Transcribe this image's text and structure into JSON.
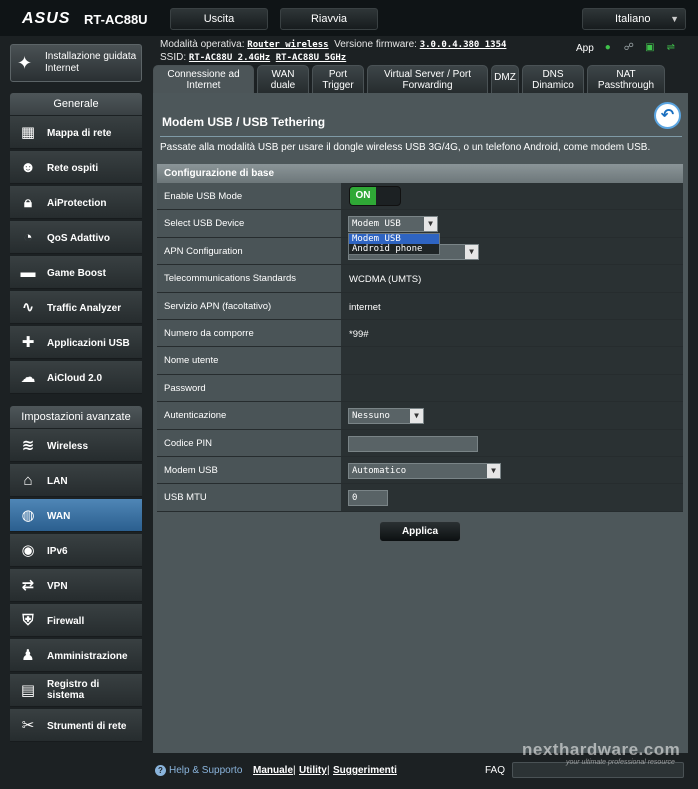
{
  "header": {
    "brand": "ASUS",
    "model": "RT-AC88U",
    "logout_label": "Uscita",
    "reboot_label": "Riavvia",
    "language": "Italiano",
    "mode_label": "Modalità operativa:",
    "mode_value": "Router wireless",
    "firmware_label": "Versione firmware:",
    "firmware_value": "3.0.0.4.380_1354",
    "ssid_label": "SSID:",
    "ssid_24": "RT-AC88U_2.4GHz",
    "ssid_5": "RT-AC88U_5GHz",
    "app_label": "App"
  },
  "sidebar": {
    "qis_label": "Installazione guidata Internet",
    "general_title": "Generale",
    "general_items": [
      {
        "label": "Mappa di rete"
      },
      {
        "label": "Rete ospiti"
      },
      {
        "label": "AiProtection"
      },
      {
        "label": "QoS Adattivo"
      },
      {
        "label": "Game Boost"
      },
      {
        "label": "Traffic Analyzer"
      },
      {
        "label": "Applicazioni USB"
      },
      {
        "label": "AiCloud 2.0"
      }
    ],
    "advanced_title": "Impostazioni avanzate",
    "advanced_items": [
      {
        "label": "Wireless"
      },
      {
        "label": "LAN"
      },
      {
        "label": "WAN"
      },
      {
        "label": "IPv6"
      },
      {
        "label": "VPN"
      },
      {
        "label": "Firewall"
      },
      {
        "label": "Amministrazione"
      },
      {
        "label": "Registro di sistema"
      },
      {
        "label": "Strumenti di rete"
      }
    ]
  },
  "tabs": [
    {
      "label": "Connessione ad Internet"
    },
    {
      "label": "WAN duale"
    },
    {
      "label": "Port Trigger"
    },
    {
      "label": "Virtual Server / Port Forwarding"
    },
    {
      "label": "DMZ"
    },
    {
      "label": "DNS Dinamico"
    },
    {
      "label": "NAT Passthrough"
    }
  ],
  "main": {
    "title": "Modem USB / USB Tethering",
    "description": "Passate alla modalità USB per usare il dongle wireless USB 3G/4G, o un telefono Android, come modem USB.",
    "section_title": "Configurazione di base",
    "rows": {
      "enable_usb": {
        "label": "Enable USB Mode",
        "value": "ON"
      },
      "select_device": {
        "label": "Select USB Device",
        "value": "Modem USB"
      },
      "apn_config": {
        "label": "APN Configuration"
      },
      "telecom_std": {
        "label": "Telecommunications Standards",
        "value": "WCDMA (UMTS)"
      },
      "apn_service": {
        "label": "Servizio APN (facoltativo)",
        "value": "internet"
      },
      "dial_number": {
        "label": "Numero da comporre",
        "value": "*99#"
      },
      "username": {
        "label": "Nome utente",
        "value": ""
      },
      "password": {
        "label": "Password",
        "value": ""
      },
      "auth": {
        "label": "Autenticazione",
        "value": "Nessuno"
      },
      "pin": {
        "label": "Codice PIN",
        "value": ""
      },
      "modem": {
        "label": "Modem USB",
        "value": "Automatico"
      },
      "mtu": {
        "label": "USB MTU",
        "value": "0"
      }
    },
    "device_options": [
      "Modem USB",
      "Android phone"
    ],
    "apply_label": "Applica"
  },
  "footer": {
    "help_label": "Help & Supporto",
    "manual_label": "Manuale",
    "utility_label": "Utility",
    "suggestions_label": "Suggerimenti",
    "separator": "|",
    "faq_label": "FAQ",
    "watermark": "nexthardware.com",
    "watermark_sub": "your ultimate professional resource"
  },
  "colors": {
    "accent_active": "#3d74a6",
    "toggle_on": "#2fa836",
    "dropdown_highlight": "#2e64c2"
  }
}
